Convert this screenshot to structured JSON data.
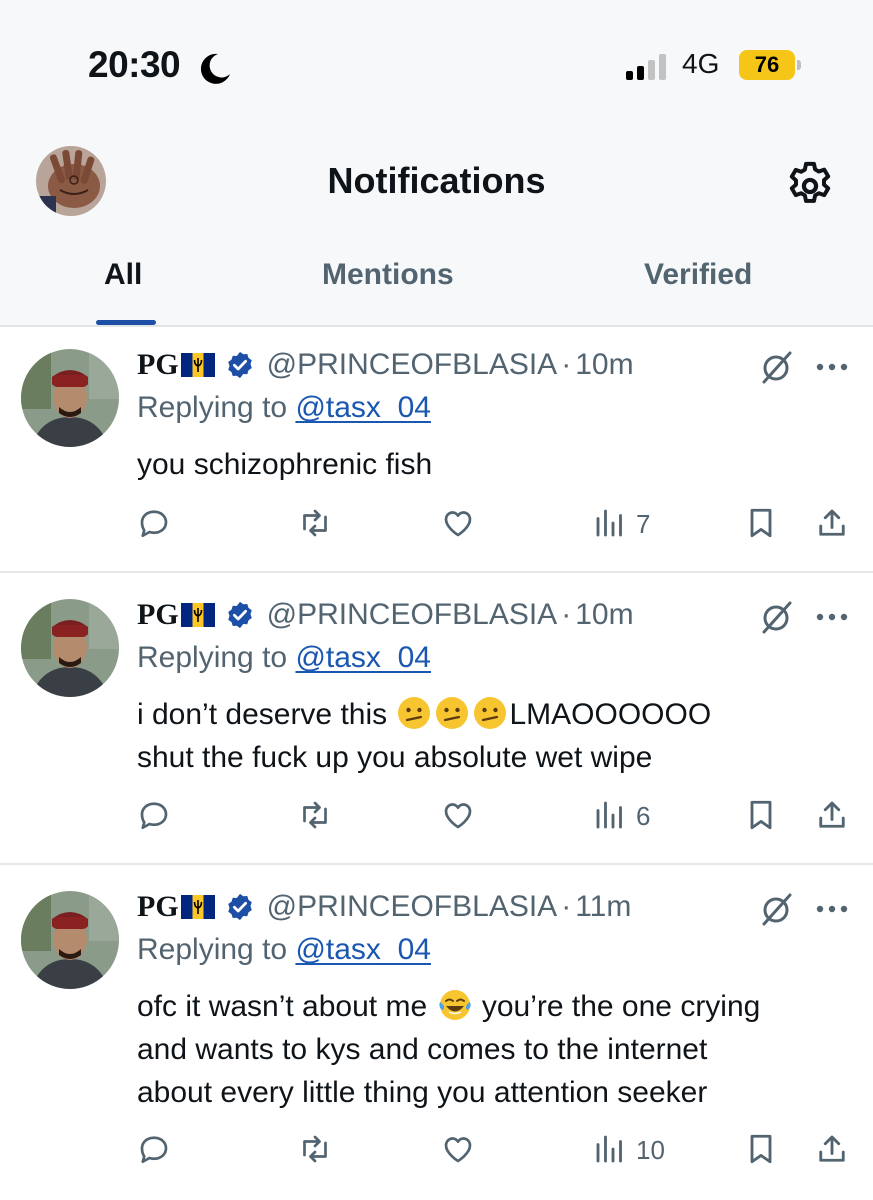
{
  "status_bar": {
    "time": "20:30",
    "network": "4G",
    "battery": "76",
    "battery_color": "#f5c518"
  },
  "header": {
    "title": "Notifications",
    "settings_icon": "gear-icon"
  },
  "tabs": [
    {
      "label": "All",
      "active": true
    },
    {
      "label": "Mentions",
      "active": false
    },
    {
      "label": "Verified",
      "active": false
    }
  ],
  "accent_color": "#1d4fa6",
  "tweets": [
    {
      "display_name": "PG",
      "flag": "barbados-flag",
      "handle": "@PRINCEOFBLASIA",
      "separator": "·",
      "time": "10m",
      "replying_prefix": "Replying to",
      "replying_to": "@tasx_04",
      "text": [
        "you schizophrenic fish"
      ],
      "views": "7"
    },
    {
      "display_name": "PG",
      "flag": "barbados-flag",
      "handle": "@PRINCEOFBLASIA",
      "separator": "·",
      "time": "10m",
      "replying_prefix": "Replying to",
      "replying_to": "@tasx_04",
      "text_before_emoji": "i don’t deserve this",
      "emojis": [
        "confused-face",
        "confused-face",
        "confused-face"
      ],
      "text_after_emoji": "LMAOOOOOO",
      "text_line2": "shut the fuck up you absolute wet wipe",
      "views": "6"
    },
    {
      "display_name": "PG",
      "flag": "barbados-flag",
      "handle": "@PRINCEOFBLASIA",
      "separator": "·",
      "time": "11m",
      "replying_prefix": "Replying to",
      "replying_to": "@tasx_04",
      "text_before_emoji": "ofc it wasn’t about me",
      "emojis": [
        "tears-of-joy"
      ],
      "text_after_emoji": "you’re the one crying",
      "text_line2": "and wants to kys and comes to the internet",
      "text_line3": "about every little thing you attention seeker",
      "views": "10"
    }
  ]
}
